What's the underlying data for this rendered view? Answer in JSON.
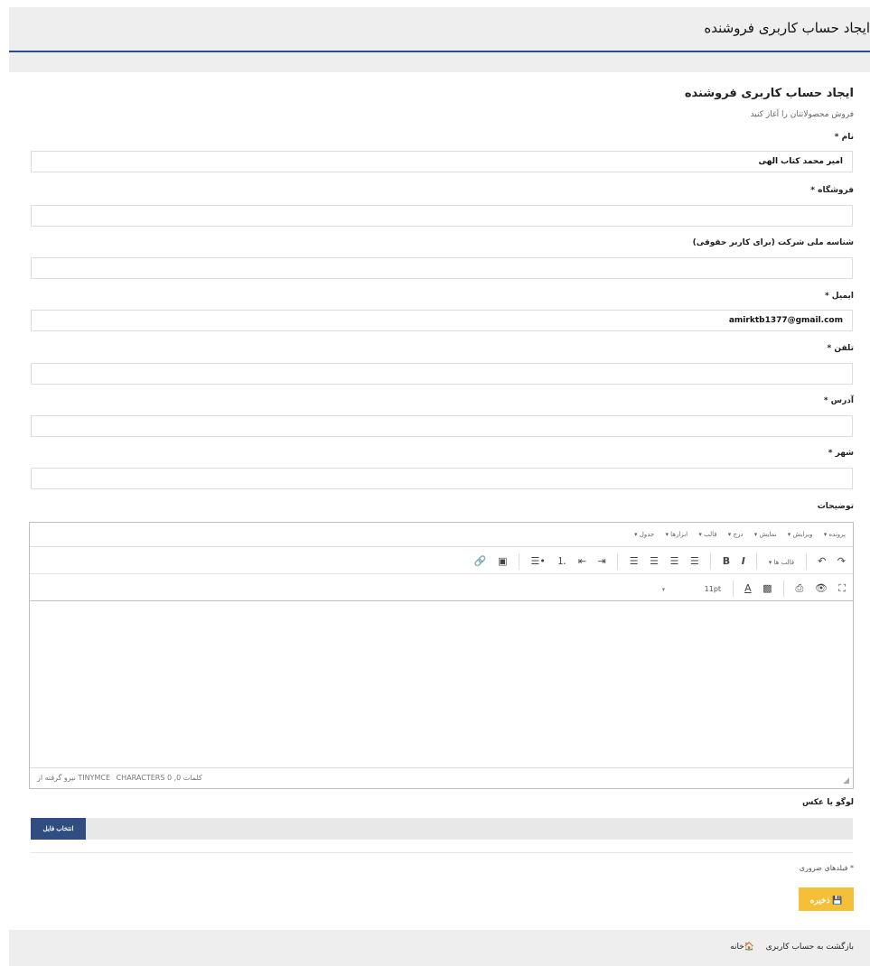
{
  "header": {
    "title": "ایجاد حساب کاربری فروشنده"
  },
  "form": {
    "title": "ایجاد حساب کاربری فروشنده",
    "subtitle": "فروش محصولاتتان را آغاز کنید",
    "fields": {
      "name_label": "نام *",
      "name_value": "امیر محمد کتاب الهی",
      "store_label": "فروشگاه *",
      "company_label": "شناسه ملی شرکت (برای کاربر حقوقی)",
      "email_label": "ایمیل *",
      "email_value": "amirktb1377@gmail.com",
      "phone_label": "تلفن *",
      "address_label": "آدرس *",
      "city_label": "شهر *",
      "description_label": "توضیحات"
    },
    "editor": {
      "menu": [
        "پرونده ▾",
        "ویرایش ▾",
        "نمایش ▾",
        "درج ▾",
        "قالب ▾",
        "ابزارها ▾",
        "جدول ▾"
      ],
      "format_label": "قالب ها ▾",
      "font_size": "11pt",
      "status": "CHARACTERS 0 ,کلمات 0",
      "powered": "نیرو گرفته از TINYMCE"
    },
    "logo_label": "لوگو یا عکس",
    "file_button": "انتخاب فایل",
    "required_note": "* فیلدهای ضروری",
    "save_button": "💾 ذخیره"
  },
  "footer": {
    "back_link": "بازگشت به حساب کاربری",
    "home_link": "🏠خانه"
  }
}
